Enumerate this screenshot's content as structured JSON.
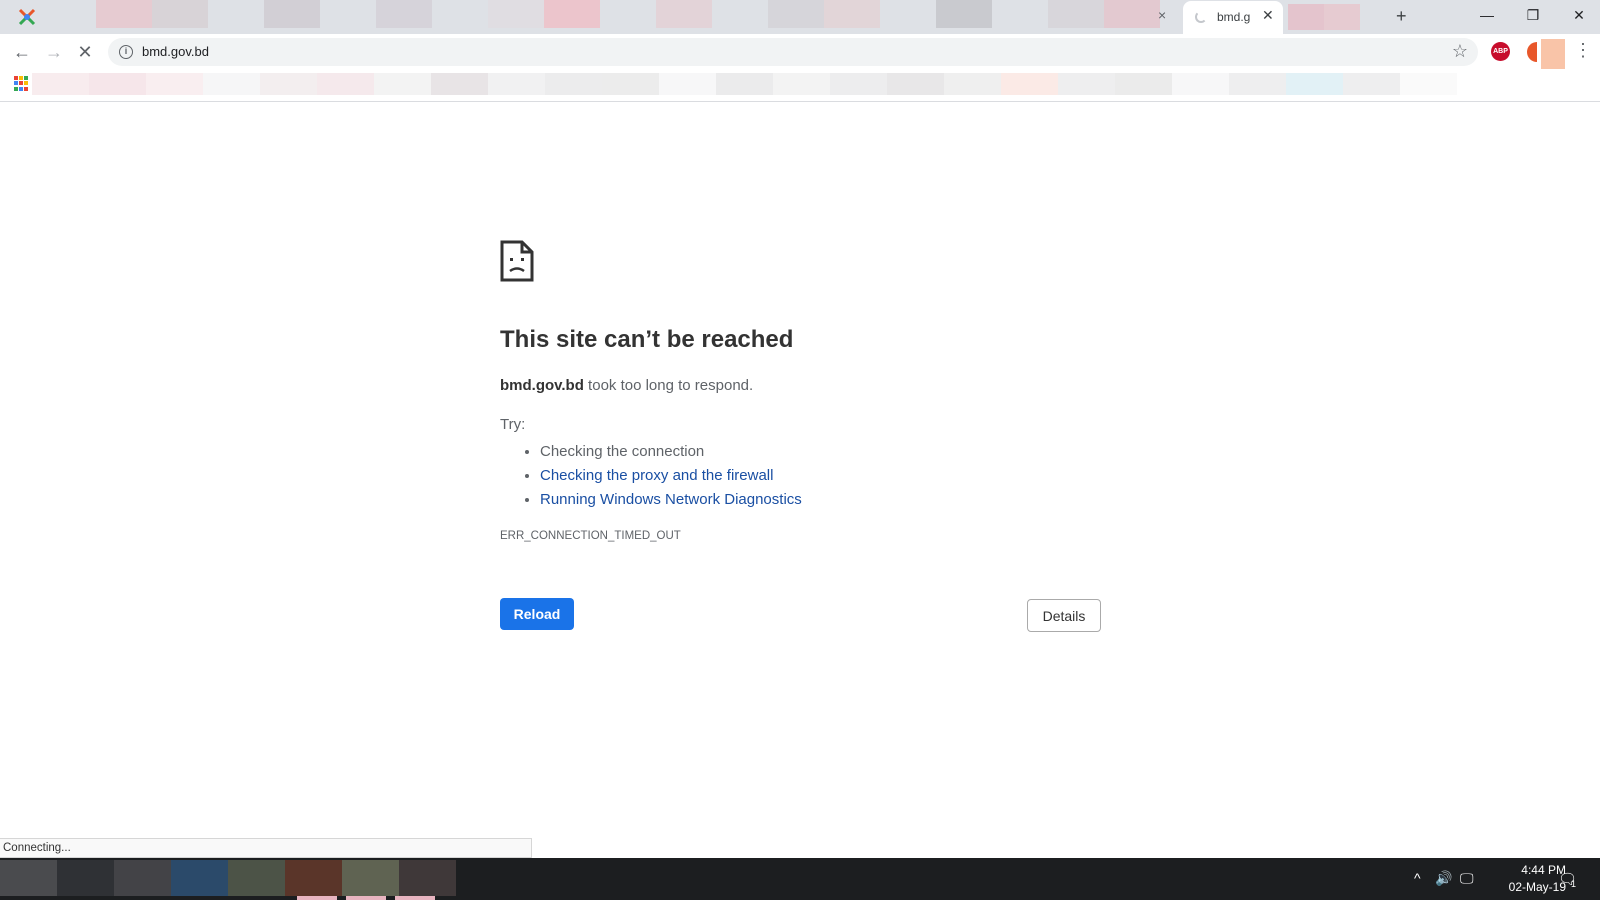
{
  "browser": {
    "active_tab": {
      "title": "bmd.g",
      "close_icon": "close-icon"
    },
    "inactive_tab_close": "×",
    "new_tab_symbol": "+",
    "window_controls": {
      "minimize": "—",
      "restore": "❐",
      "close": "✕"
    },
    "nav": {
      "back": "←",
      "forward": "→",
      "stop": "✕"
    },
    "url": "bmd.gov.bd",
    "info_symbol": "i",
    "star_symbol": "☆",
    "abp_label": "ABP",
    "menu_symbol": "⋮",
    "blurred_tab_colors": [
      "#dee1e6",
      "#e6cbd1",
      "#d8d3d7",
      "#dee1e6",
      "#d2cfd5",
      "#dee1e6",
      "#d6d3da",
      "#dee1e6",
      "#e0dde2",
      "#ecc5cc",
      "#dee1e6",
      "#e3d3d8",
      "#dee1e6",
      "#d6d5da",
      "#e2d5d8",
      "#dee1e6",
      "#c9cacf",
      "#dee1e6",
      "#d8d6db",
      "#e3c9d0",
      "#dee1e6"
    ],
    "blurred_right_tab_colors": [
      "#e4c4cd",
      "#e6cbd1",
      "#dee1e6"
    ],
    "bookmark_colors": [
      "#f8ecee",
      "#f6e6ea",
      "#f9eef0",
      "#f6f6f7",
      "#f3eeef",
      "#f5e9ec",
      "#f3f3f3",
      "#e8e4e6",
      "#f1f1f2",
      "#ececed",
      "#ececec",
      "#f7f7f8",
      "#ebebec",
      "#f3f3f3",
      "#ededee",
      "#e8e7e8",
      "#efefef",
      "#fbeae6",
      "#eeeeef",
      "#ebebeb",
      "#f7f7f8",
      "#eeeeef",
      "#e2f1f6",
      "#eeeeef",
      "#fafafa"
    ],
    "apps_colors": [
      "#ea4335",
      "#fbbc05",
      "#34a853",
      "#4285f4",
      "#ea4335",
      "#fbbc05",
      "#34a853",
      "#4285f4",
      "#ea4335"
    ]
  },
  "error_page": {
    "title": "This site can’t be reached",
    "host": "bmd.gov.bd",
    "description_suffix": " took too long to respond.",
    "try_label": "Try:",
    "suggestions": [
      {
        "text": "Checking the connection",
        "link": false
      },
      {
        "text": "Checking the proxy and the firewall",
        "link": true
      },
      {
        "text": "Running Windows Network Diagnostics",
        "link": true
      }
    ],
    "error_code": "ERR_CONNECTION_TIMED_OUT",
    "reload_label": "Reload",
    "details_label": "Details"
  },
  "status_bubble": "Connecting...",
  "taskbar": {
    "item_colors": [
      "#4a4b4e",
      "#2f3135",
      "#434347",
      "#2b4a6a",
      "#4c5347",
      "#5a3529",
      "#5f6352",
      "#3f3839"
    ],
    "tray": {
      "chevron": "^",
      "volume": "🔊",
      "network": "🖵"
    },
    "time": "4:44 PM",
    "date": "02-May-19",
    "notification_count": "1",
    "notification_symbol": "🗨"
  }
}
